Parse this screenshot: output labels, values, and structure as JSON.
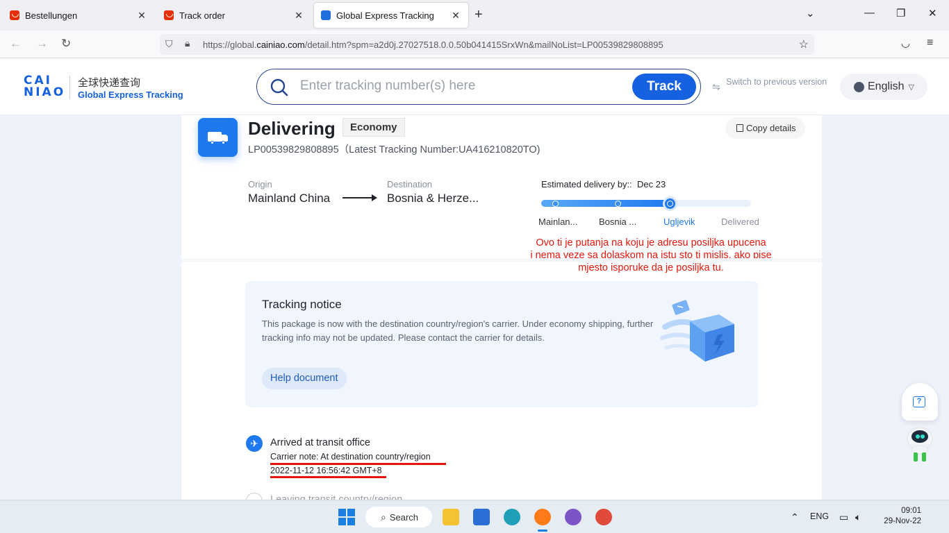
{
  "browser": {
    "tabs": [
      {
        "label": "Bestellungen"
      },
      {
        "label": "Track order"
      },
      {
        "label": "Global Express Tracking"
      }
    ],
    "url_prefix": "https://global.",
    "url_domain": "cainiao.com",
    "url_suffix": "/detail.htm?spm=a2d0j.27027518.0.0.50b041415SrxWn&mailNoList=LP00539829808895"
  },
  "header": {
    "logo_mark_line1": "CAI",
    "logo_mark_line2": "NIAO",
    "logo_cn": "全球快递查询",
    "logo_en": "Global Express Tracking",
    "search_placeholder": "Enter tracking number(s) here",
    "track_button": "Track",
    "switch_version": "Switch to previous version",
    "language": "English"
  },
  "status": {
    "title": "Delivering",
    "service": "Economy",
    "copy_details": "Copy details",
    "tracking_line": "LP00539829808895（Latest Tracking Number:UA416210820TO)"
  },
  "route": {
    "origin_label": "Origin",
    "origin": "Mainland China",
    "destination_label": "Destination",
    "destination": "Bosnia & Herze...",
    "eta_label": "Estimated delivery by::",
    "eta_date": "Dec 23",
    "progress_fraction": 0.62,
    "steps": [
      "Mainlan...",
      "Bosnia ...",
      "Ugljevik",
      "Delivered"
    ],
    "current_step": 2
  },
  "annotation": {
    "lines": [
      "Ovo ti je putanja na koju je adresu posiljka upucena",
      "i nema veze sa dolaskom na istu sto ti mislis, ako pise",
      "mjesto isporuke da je posiljka tu."
    ],
    "color": "#e8160c"
  },
  "notice": {
    "title": "Tracking notice",
    "text": "This package is now with the destination country/region's carrier. Under economy shipping, further tracking info may not be updated. Please contact the carrier for details.",
    "help_button": "Help document"
  },
  "timeline": [
    {
      "title": "Arrived at transit office",
      "note": "Carrier note: At destination country/region",
      "time": "2022-11-12 16:56:42 GMT+8"
    },
    {
      "title": "Leaving transit country/region"
    }
  ],
  "taskbar": {
    "search_label": "Search",
    "language": "ENG",
    "time": "09:01",
    "date": "29-Nov-22"
  },
  "colors": {
    "brand_blue": "#1661e0",
    "accent_blue": "#1e78f0",
    "annotation_red": "#e8160c"
  }
}
